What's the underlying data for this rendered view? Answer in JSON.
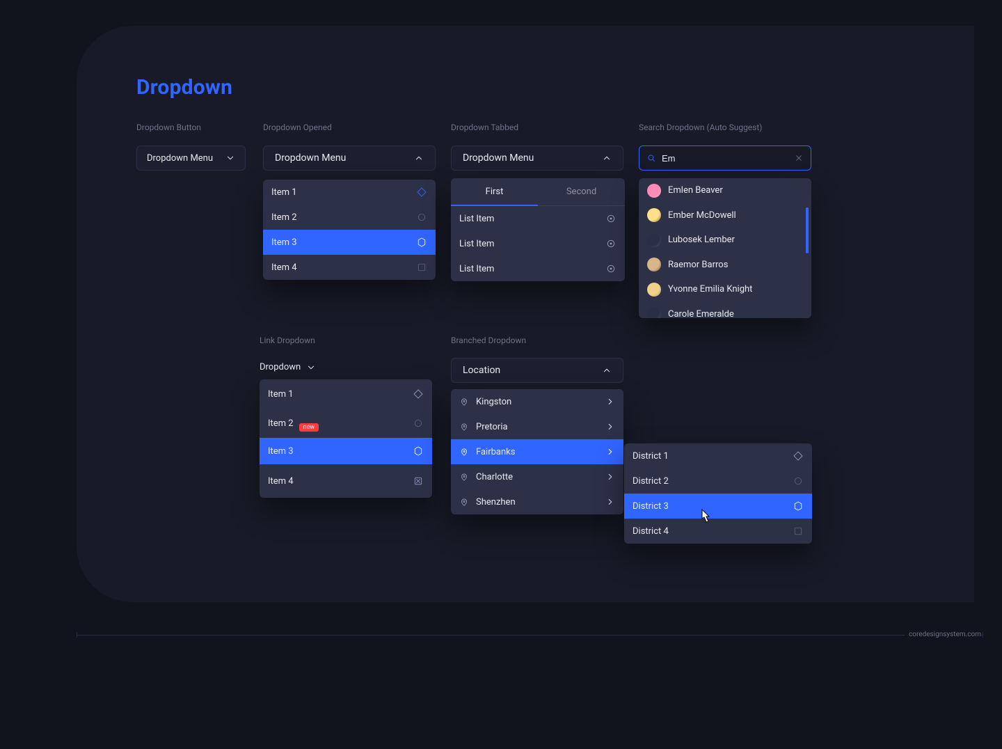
{
  "page": {
    "title": "Dropdown"
  },
  "sections": {
    "button": "Dropdown Button",
    "opened": "Dropdown Opened",
    "tabbed": "Dropdown Tabbed",
    "search": "Search Dropdown (Auto Suggest)",
    "link": "Link Dropdown",
    "branched": "Branched Dropdown"
  },
  "dropdown_button": {
    "label": "Dropdown Menu"
  },
  "dropdown_opened": {
    "label": "Dropdown Menu",
    "items": [
      {
        "label": "Item 1",
        "icon": "diamond-icon",
        "selected": false,
        "accent": true
      },
      {
        "label": "Item 2",
        "icon": "circle-icon",
        "selected": false
      },
      {
        "label": "Item 3",
        "icon": "hexagon-icon",
        "selected": true
      },
      {
        "label": "Item 4",
        "icon": "square-icon",
        "selected": false
      }
    ]
  },
  "dropdown_tabbed": {
    "label": "Dropdown Menu",
    "tabs": [
      {
        "label": "First",
        "active": true
      },
      {
        "label": "Second",
        "active": false
      }
    ],
    "item_label": "List Item",
    "items": [
      "List Item",
      "List Item",
      "List Item"
    ]
  },
  "search": {
    "query": "Em",
    "results": [
      {
        "name": "Emlen Beaver"
      },
      {
        "name": "Ember McDowell"
      },
      {
        "name": "Lubosek Lember"
      },
      {
        "name": "Raemor Barros"
      },
      {
        "name": "Yvonne Emilia Knight"
      },
      {
        "name": "Carole Emeralde"
      }
    ]
  },
  "link_dropdown": {
    "label": "Dropdown",
    "items": [
      {
        "label": "Item 1",
        "icon": "diamond-icon"
      },
      {
        "label": "Item 2",
        "icon": "circle-icon",
        "badge": "new"
      },
      {
        "label": "Item 3",
        "icon": "hexagon-icon",
        "selected": true
      },
      {
        "label": "Item 4",
        "icon": "square-x-icon"
      }
    ]
  },
  "branched": {
    "label": "Location",
    "locations": [
      {
        "label": "Kingston"
      },
      {
        "label": "Pretoria"
      },
      {
        "label": "Fairbanks",
        "selected": true
      },
      {
        "label": "Charlotte"
      },
      {
        "label": "Shenzhen"
      }
    ],
    "districts": [
      {
        "label": "District 1",
        "icon": "diamond-icon"
      },
      {
        "label": "District 2",
        "icon": "circle-icon"
      },
      {
        "label": "District 3",
        "icon": "hexagon-icon",
        "selected": true
      },
      {
        "label": "District 4",
        "icon": "square-icon"
      }
    ]
  },
  "footer": {
    "text": "coredesignsystem.com"
  },
  "colors": {
    "bg": "#11131d",
    "card": "#181a27",
    "panel": "#2d3148",
    "accent": "#3065ff",
    "text": "#e8e9ee",
    "muted": "#6f7285",
    "danger": "#ff3b3b"
  },
  "avatars": {
    "0": {
      "bg": "#ff8ab5",
      "ring": "#ffb0cd"
    },
    "1": {
      "bg": "#ffe08a",
      "ring": "#7a5a2a"
    },
    "2": {
      "bg": "#2b2f45",
      "ring": "#4b4f6a"
    },
    "3": {
      "bg": "#d8b58a",
      "ring": "#7a5a2a"
    },
    "4": {
      "bg": "#f1d08a",
      "ring": "#c0975a"
    },
    "5": {
      "bg": "#2b2f45",
      "ring": "#4b4f6a"
    }
  }
}
